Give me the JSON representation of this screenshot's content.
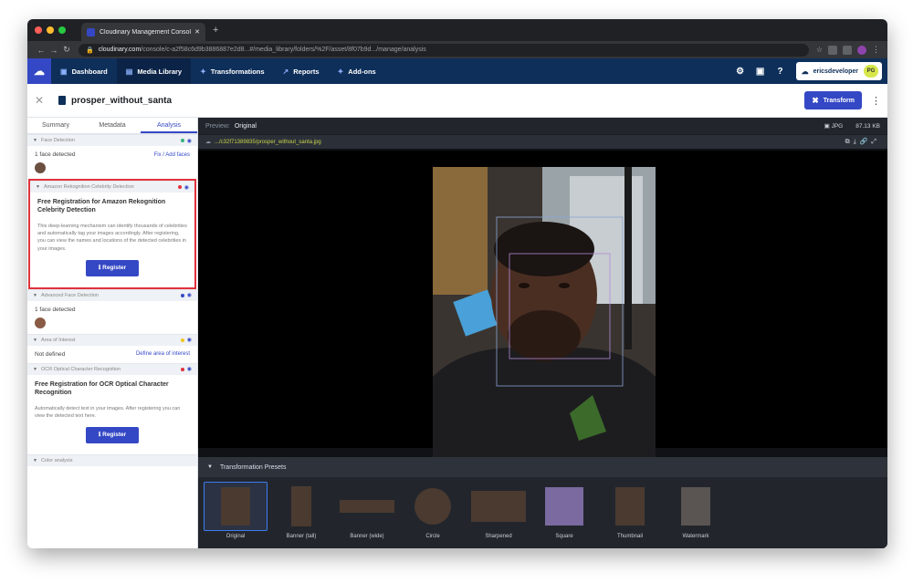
{
  "browser": {
    "tab_title": "Cloudinary Management Consol",
    "url_domain": "cloudinary.com",
    "url_path": "/console/c-a2f58c6d9b3886887e2d8...#/media_library/folders/%2F/asset/8f07b9d.../manage/analysis"
  },
  "appnav": {
    "items": [
      {
        "icon": "▣",
        "label": "Dashboard"
      },
      {
        "icon": "▤",
        "label": "Media Library"
      },
      {
        "icon": "✦",
        "label": "Transformations"
      },
      {
        "icon": "↗",
        "label": "Reports"
      },
      {
        "icon": "✦",
        "label": "Add-ons"
      }
    ],
    "account_name": "ericsdeveloper",
    "account_badge": "PG"
  },
  "asset": {
    "name": "prosper_without_santa",
    "sub": "ID",
    "transform_label": "Transform"
  },
  "panel": {
    "tabs": [
      "Summary",
      "Metadata",
      "Analysis"
    ],
    "face_detection": {
      "title": "Face Detection",
      "count": "1 face detected",
      "link": "Fix / Add faces"
    },
    "celebrity": {
      "title": "Amazon Rekognition Celebrity Detection",
      "promo_title": "Free Registration for Amazon Rekognition Celebrity Detection",
      "promo_desc": "This deep-learning mechanism can identify thousands of celebrities and automatically tag your images accordingly. After registering, you can view the names and locations of the detected celebrities in your images.",
      "button": "Register"
    },
    "adv_face": {
      "title": "Advanced Face Detection",
      "count": "1 face detected"
    },
    "aoi": {
      "title": "Area of Interest",
      "status": "Not defined",
      "link": "Define area of interest"
    },
    "ocr": {
      "title": "OCR Optical Character Recognition",
      "promo_title": "Free Registration for OCR Optical Character Recognition",
      "promo_desc": "Automatically detect text in your images. After registering you can view the detected text here.",
      "button": "Register"
    },
    "color": {
      "title": "Color analysis"
    }
  },
  "preview": {
    "label": "Preview:",
    "value": "Original",
    "format": "JPG",
    "size": "87.13 KB",
    "path": ".../c32f71389835/prosper_without_santa.jpg"
  },
  "presets": {
    "title": "Transformation Presets",
    "items": [
      "Original",
      "Banner (tall)",
      "Banner (wide)",
      "Circle",
      "Sharpened",
      "Square",
      "Thumbnail",
      "Watermark"
    ]
  },
  "colors": {
    "brand": "#3448c5",
    "nav": "#0e2f5a",
    "highlight": "#e0323c"
  }
}
